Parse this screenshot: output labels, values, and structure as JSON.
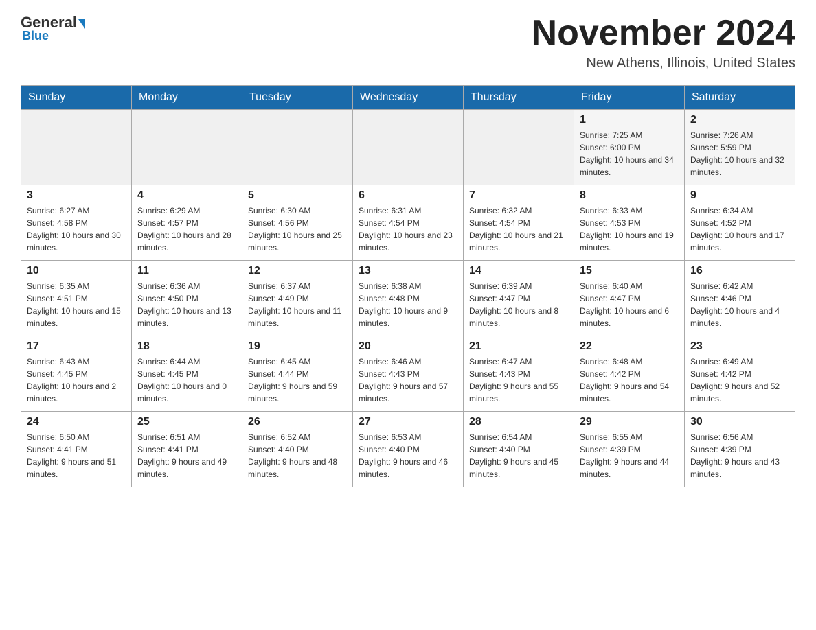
{
  "header": {
    "logo_general": "General",
    "logo_blue": "Blue",
    "month_title": "November 2024",
    "location": "New Athens, Illinois, United States"
  },
  "days_of_week": [
    "Sunday",
    "Monday",
    "Tuesday",
    "Wednesday",
    "Thursday",
    "Friday",
    "Saturday"
  ],
  "weeks": [
    [
      {
        "day": "",
        "sunrise": "",
        "sunset": "",
        "daylight": ""
      },
      {
        "day": "",
        "sunrise": "",
        "sunset": "",
        "daylight": ""
      },
      {
        "day": "",
        "sunrise": "",
        "sunset": "",
        "daylight": ""
      },
      {
        "day": "",
        "sunrise": "",
        "sunset": "",
        "daylight": ""
      },
      {
        "day": "",
        "sunrise": "",
        "sunset": "",
        "daylight": ""
      },
      {
        "day": "1",
        "sunrise": "Sunrise: 7:25 AM",
        "sunset": "Sunset: 6:00 PM",
        "daylight": "Daylight: 10 hours and 34 minutes."
      },
      {
        "day": "2",
        "sunrise": "Sunrise: 7:26 AM",
        "sunset": "Sunset: 5:59 PM",
        "daylight": "Daylight: 10 hours and 32 minutes."
      }
    ],
    [
      {
        "day": "3",
        "sunrise": "Sunrise: 6:27 AM",
        "sunset": "Sunset: 4:58 PM",
        "daylight": "Daylight: 10 hours and 30 minutes."
      },
      {
        "day": "4",
        "sunrise": "Sunrise: 6:29 AM",
        "sunset": "Sunset: 4:57 PM",
        "daylight": "Daylight: 10 hours and 28 minutes."
      },
      {
        "day": "5",
        "sunrise": "Sunrise: 6:30 AM",
        "sunset": "Sunset: 4:56 PM",
        "daylight": "Daylight: 10 hours and 25 minutes."
      },
      {
        "day": "6",
        "sunrise": "Sunrise: 6:31 AM",
        "sunset": "Sunset: 4:54 PM",
        "daylight": "Daylight: 10 hours and 23 minutes."
      },
      {
        "day": "7",
        "sunrise": "Sunrise: 6:32 AM",
        "sunset": "Sunset: 4:54 PM",
        "daylight": "Daylight: 10 hours and 21 minutes."
      },
      {
        "day": "8",
        "sunrise": "Sunrise: 6:33 AM",
        "sunset": "Sunset: 4:53 PM",
        "daylight": "Daylight: 10 hours and 19 minutes."
      },
      {
        "day": "9",
        "sunrise": "Sunrise: 6:34 AM",
        "sunset": "Sunset: 4:52 PM",
        "daylight": "Daylight: 10 hours and 17 minutes."
      }
    ],
    [
      {
        "day": "10",
        "sunrise": "Sunrise: 6:35 AM",
        "sunset": "Sunset: 4:51 PM",
        "daylight": "Daylight: 10 hours and 15 minutes."
      },
      {
        "day": "11",
        "sunrise": "Sunrise: 6:36 AM",
        "sunset": "Sunset: 4:50 PM",
        "daylight": "Daylight: 10 hours and 13 minutes."
      },
      {
        "day": "12",
        "sunrise": "Sunrise: 6:37 AM",
        "sunset": "Sunset: 4:49 PM",
        "daylight": "Daylight: 10 hours and 11 minutes."
      },
      {
        "day": "13",
        "sunrise": "Sunrise: 6:38 AM",
        "sunset": "Sunset: 4:48 PM",
        "daylight": "Daylight: 10 hours and 9 minutes."
      },
      {
        "day": "14",
        "sunrise": "Sunrise: 6:39 AM",
        "sunset": "Sunset: 4:47 PM",
        "daylight": "Daylight: 10 hours and 8 minutes."
      },
      {
        "day": "15",
        "sunrise": "Sunrise: 6:40 AM",
        "sunset": "Sunset: 4:47 PM",
        "daylight": "Daylight: 10 hours and 6 minutes."
      },
      {
        "day": "16",
        "sunrise": "Sunrise: 6:42 AM",
        "sunset": "Sunset: 4:46 PM",
        "daylight": "Daylight: 10 hours and 4 minutes."
      }
    ],
    [
      {
        "day": "17",
        "sunrise": "Sunrise: 6:43 AM",
        "sunset": "Sunset: 4:45 PM",
        "daylight": "Daylight: 10 hours and 2 minutes."
      },
      {
        "day": "18",
        "sunrise": "Sunrise: 6:44 AM",
        "sunset": "Sunset: 4:45 PM",
        "daylight": "Daylight: 10 hours and 0 minutes."
      },
      {
        "day": "19",
        "sunrise": "Sunrise: 6:45 AM",
        "sunset": "Sunset: 4:44 PM",
        "daylight": "Daylight: 9 hours and 59 minutes."
      },
      {
        "day": "20",
        "sunrise": "Sunrise: 6:46 AM",
        "sunset": "Sunset: 4:43 PM",
        "daylight": "Daylight: 9 hours and 57 minutes."
      },
      {
        "day": "21",
        "sunrise": "Sunrise: 6:47 AM",
        "sunset": "Sunset: 4:43 PM",
        "daylight": "Daylight: 9 hours and 55 minutes."
      },
      {
        "day": "22",
        "sunrise": "Sunrise: 6:48 AM",
        "sunset": "Sunset: 4:42 PM",
        "daylight": "Daylight: 9 hours and 54 minutes."
      },
      {
        "day": "23",
        "sunrise": "Sunrise: 6:49 AM",
        "sunset": "Sunset: 4:42 PM",
        "daylight": "Daylight: 9 hours and 52 minutes."
      }
    ],
    [
      {
        "day": "24",
        "sunrise": "Sunrise: 6:50 AM",
        "sunset": "Sunset: 4:41 PM",
        "daylight": "Daylight: 9 hours and 51 minutes."
      },
      {
        "day": "25",
        "sunrise": "Sunrise: 6:51 AM",
        "sunset": "Sunset: 4:41 PM",
        "daylight": "Daylight: 9 hours and 49 minutes."
      },
      {
        "day": "26",
        "sunrise": "Sunrise: 6:52 AM",
        "sunset": "Sunset: 4:40 PM",
        "daylight": "Daylight: 9 hours and 48 minutes."
      },
      {
        "day": "27",
        "sunrise": "Sunrise: 6:53 AM",
        "sunset": "Sunset: 4:40 PM",
        "daylight": "Daylight: 9 hours and 46 minutes."
      },
      {
        "day": "28",
        "sunrise": "Sunrise: 6:54 AM",
        "sunset": "Sunset: 4:40 PM",
        "daylight": "Daylight: 9 hours and 45 minutes."
      },
      {
        "day": "29",
        "sunrise": "Sunrise: 6:55 AM",
        "sunset": "Sunset: 4:39 PM",
        "daylight": "Daylight: 9 hours and 44 minutes."
      },
      {
        "day": "30",
        "sunrise": "Sunrise: 6:56 AM",
        "sunset": "Sunset: 4:39 PM",
        "daylight": "Daylight: 9 hours and 43 minutes."
      }
    ]
  ]
}
